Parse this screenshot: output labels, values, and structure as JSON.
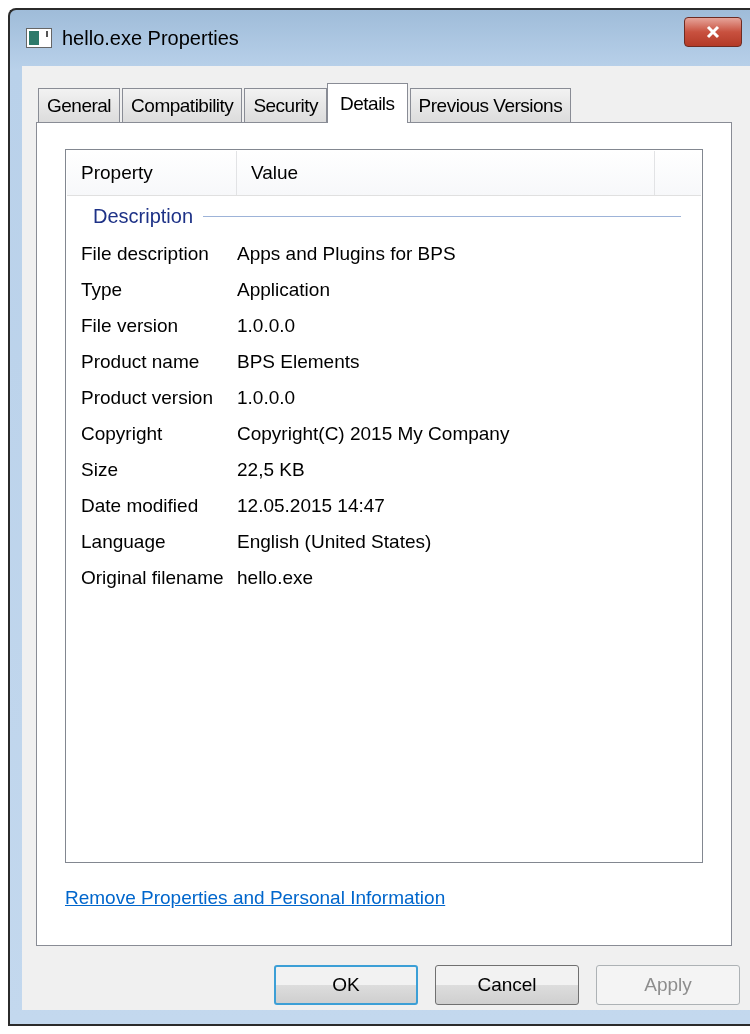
{
  "window": {
    "title": "hello.exe Properties"
  },
  "tabs": [
    {
      "label": "General",
      "selected": false
    },
    {
      "label": "Compatibility",
      "selected": false
    },
    {
      "label": "Security",
      "selected": false
    },
    {
      "label": "Details",
      "selected": true
    },
    {
      "label": "Previous Versions",
      "selected": false
    }
  ],
  "table": {
    "columns": [
      "Property",
      "Value"
    ],
    "group": "Description",
    "rows": [
      {
        "property": "File description",
        "value": "Apps and Plugins for BPS"
      },
      {
        "property": "Type",
        "value": "Application"
      },
      {
        "property": "File version",
        "value": "1.0.0.0"
      },
      {
        "property": "Product name",
        "value": "BPS Elements"
      },
      {
        "property": "Product version",
        "value": "1.0.0.0"
      },
      {
        "property": "Copyright",
        "value": "Copyright(C) 2015 My Company"
      },
      {
        "property": "Size",
        "value": "22,5 KB"
      },
      {
        "property": "Date modified",
        "value": "12.05.2015 14:47"
      },
      {
        "property": "Language",
        "value": "English (United States)"
      },
      {
        "property": "Original filename",
        "value": "hello.exe"
      }
    ]
  },
  "link": "Remove Properties and Personal Information",
  "buttons": [
    {
      "label": "OK",
      "default": true,
      "disabled": false
    },
    {
      "label": "Cancel",
      "default": false,
      "disabled": false
    },
    {
      "label": "Apply",
      "default": false,
      "disabled": true
    }
  ]
}
